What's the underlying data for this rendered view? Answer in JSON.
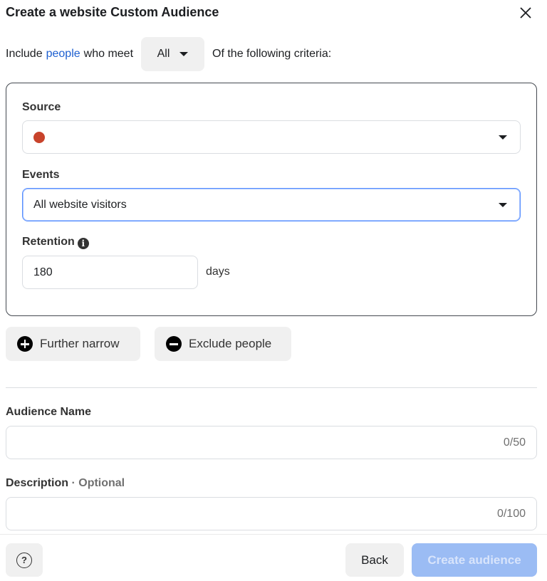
{
  "dialog": {
    "title": "Create a website Custom Audience",
    "close_icon": "close-icon"
  },
  "include": {
    "prefix": "Include",
    "link": "people",
    "middle": "who meet",
    "match_selected": "All",
    "suffix": "Of the following criteria:"
  },
  "criteria": {
    "source_label": "Source",
    "source_value": "",
    "source_status_color": "#c8432b",
    "events_label": "Events",
    "events_value": "All website visitors",
    "retention_label": "Retention",
    "retention_value": "180",
    "retention_unit": "days"
  },
  "actions": {
    "further_narrow": "Further narrow",
    "exclude_people": "Exclude people"
  },
  "audience_name": {
    "label": "Audience Name",
    "value": "",
    "counter": "0/50"
  },
  "description": {
    "label": "Description",
    "optional": "· Optional",
    "value": "",
    "counter": "0/100"
  },
  "footer": {
    "help_icon": "question-circle-icon",
    "back": "Back",
    "create": "Create audience"
  },
  "colors": {
    "link": "#1d5fd0",
    "primary_disabled": "#9bbcf4",
    "focus_border": "#5890ff"
  }
}
